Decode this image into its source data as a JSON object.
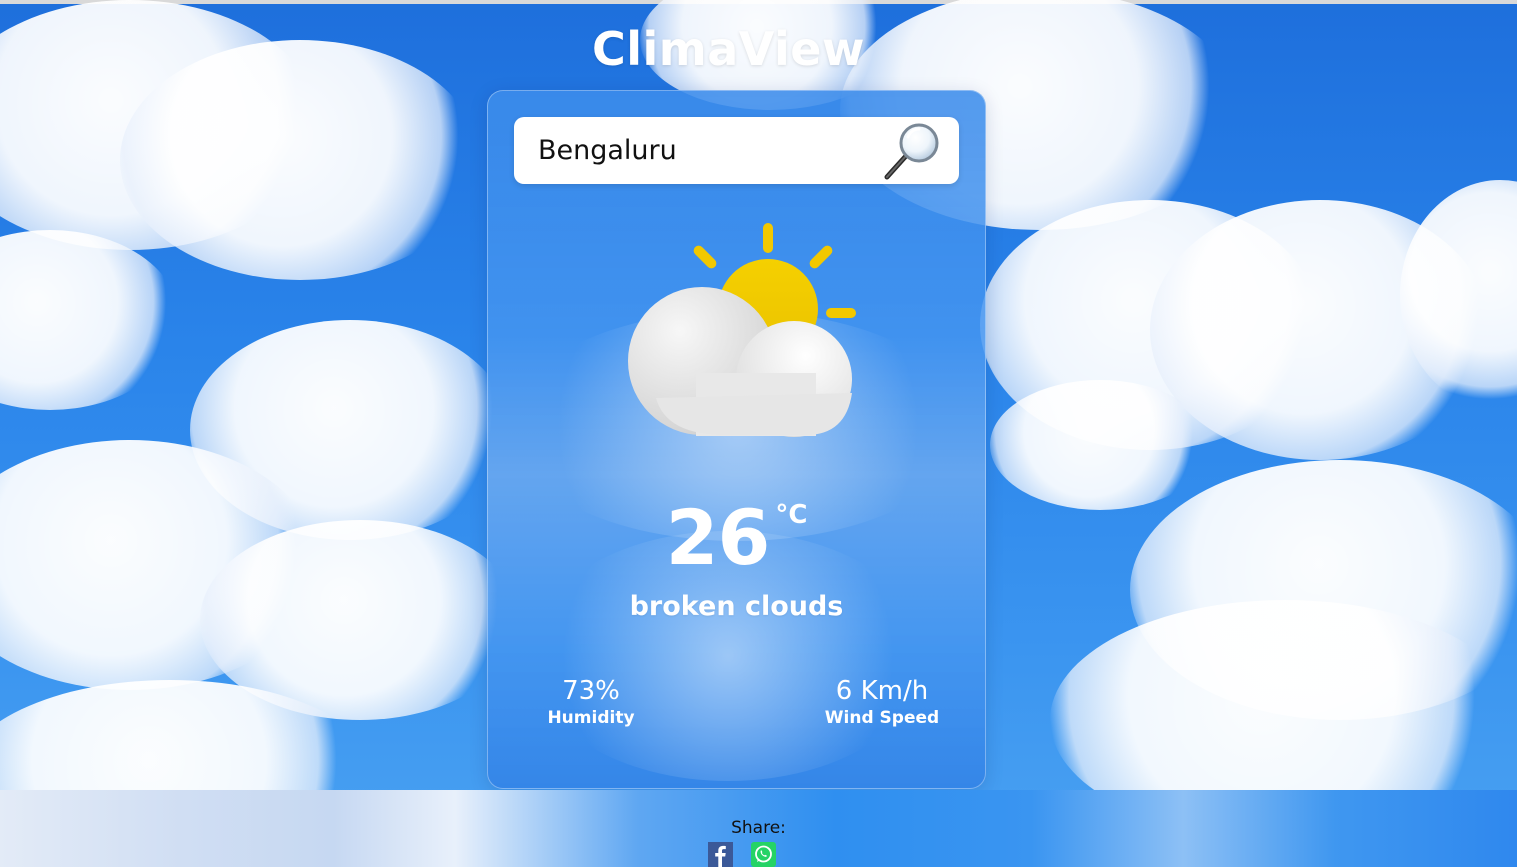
{
  "app": {
    "title": "ClimaView"
  },
  "search": {
    "value": "Bengaluru",
    "icon": "magnifier-icon"
  },
  "weather": {
    "icon": "partly-cloudy-icon",
    "temperature": "26",
    "unit": "°C",
    "condition": "broken clouds"
  },
  "stats": {
    "humidity": {
      "value": "73%",
      "label": "Humidity"
    },
    "wind": {
      "value": "6 Km/h",
      "label": "Wind Speed"
    }
  },
  "footer": {
    "share_label": "Share:",
    "share_targets": [
      "facebook-icon",
      "whatsapp-icon"
    ]
  },
  "colors": {
    "sky": "#1e6fdc",
    "sun": "#f2c800",
    "facebook": "#3b5998",
    "whatsapp": "#25d366"
  }
}
